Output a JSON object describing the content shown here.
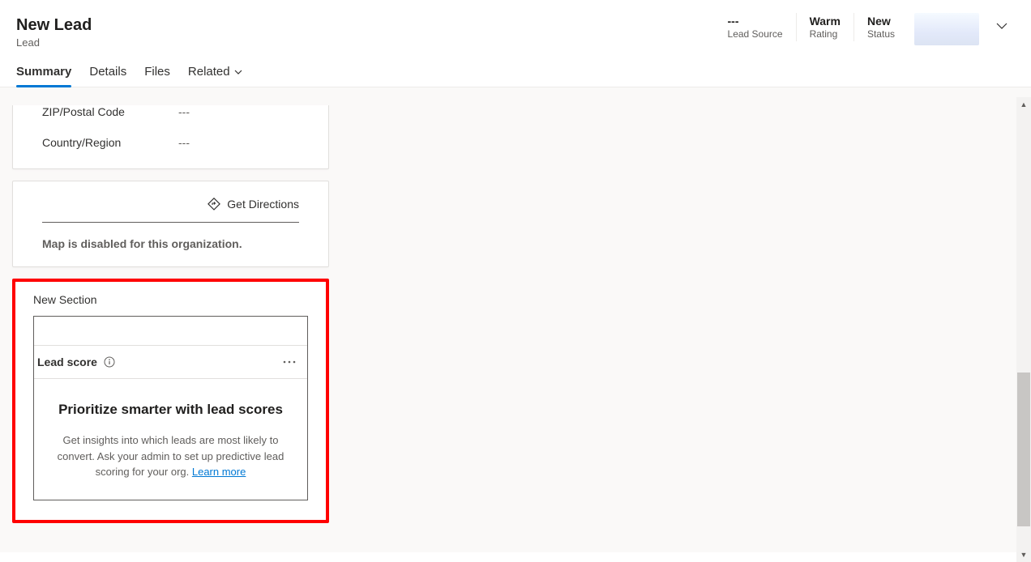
{
  "header": {
    "title": "New Lead",
    "subtitle": "Lead",
    "fields": [
      {
        "value": "---",
        "label": "Lead Source"
      },
      {
        "value": "Warm",
        "label": "Rating"
      },
      {
        "value": "New",
        "label": "Status"
      }
    ]
  },
  "tabs": [
    {
      "label": "Summary",
      "active": true
    },
    {
      "label": "Details"
    },
    {
      "label": "Files"
    },
    {
      "label": "Related",
      "hasChevron": true
    }
  ],
  "address": {
    "rows": [
      {
        "label": "ZIP/Postal Code",
        "value": "---"
      },
      {
        "label": "Country/Region",
        "value": "---"
      }
    ]
  },
  "map": {
    "get_directions": "Get Directions",
    "disabled_msg": "Map is disabled for this organization."
  },
  "section": {
    "title": "New Section",
    "card_title": "Lead score",
    "headline": "Prioritize smarter with lead scores",
    "description": "Get insights into which leads are most likely to convert. Ask your admin to set up predictive lead scoring for your org. ",
    "learn_more": "Learn more"
  }
}
